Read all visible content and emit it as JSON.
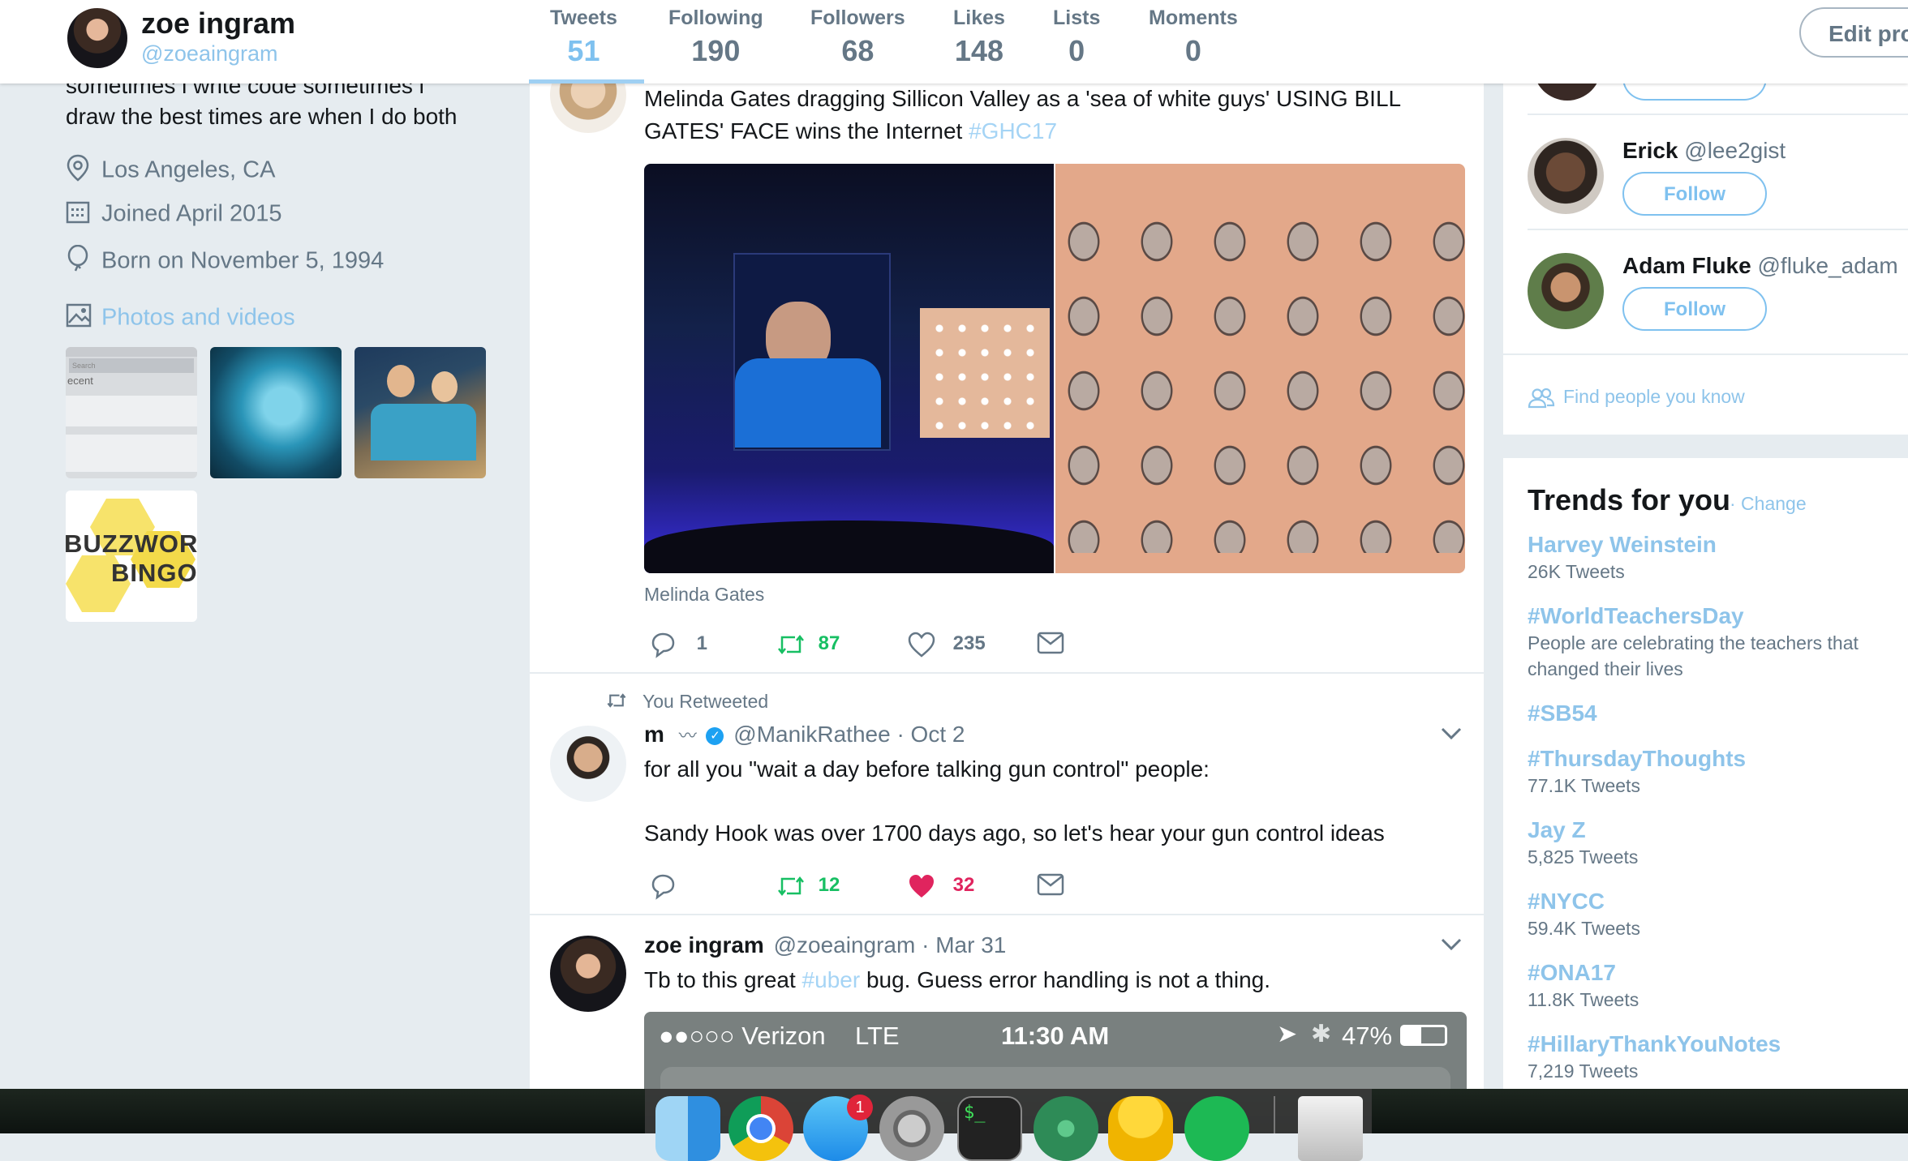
{
  "profile": {
    "name": "zoe ingram",
    "handle": "@zoeaingram",
    "bio_line1": "sometimes i write code sometimes i",
    "bio_line2": "draw the best times are when I do both",
    "location": "Los Angeles, CA",
    "joined": "Joined April 2015",
    "born": "Born on November 5, 1994",
    "photos_label": "Photos and videos",
    "edit_button": "Edit pro"
  },
  "stats": [
    {
      "label": "Tweets",
      "value": "51"
    },
    {
      "label": "Following",
      "value": "190"
    },
    {
      "label": "Followers",
      "value": "68"
    },
    {
      "label": "Likes",
      "value": "148"
    },
    {
      "label": "Lists",
      "value": "0"
    },
    {
      "label": "Moments",
      "value": "0"
    }
  ],
  "thumbs": {
    "t1_search": "Search",
    "t1_recent": "ecent",
    "t5_line1": "BUZZWORD",
    "t5_line2": "BINGO"
  },
  "tweet1": {
    "text_line1": "Melinda Gates dragging Sillicon Valley as a 'sea of white guys' USING BILL",
    "text_line2": "GATES' FACE wins the Internet ",
    "hashtag": "#GHC17",
    "caption": "Melinda Gates",
    "replies": "1",
    "retweets": "87",
    "likes": "235"
  },
  "tweet2": {
    "retweet_note": "You Retweeted",
    "author": "m",
    "author_deco": "〰",
    "handle": "@ManikRathee",
    "date": "· Oct 2",
    "line1": "for all you \"wait a day before talking gun control\" people:",
    "line2": "Sandy Hook was over 1700 days ago, so let's hear your gun control ideas",
    "retweets": "12",
    "likes": "32"
  },
  "tweet3": {
    "author": "zoe ingram",
    "handle": "@zoeaingram",
    "date": "· Mar 31",
    "text_before": "Tb to this great ",
    "hashtag": "#uber",
    "text_after": " bug. Guess error handling is not a thing.",
    "phone_carrier": "●●○○○ Verizon",
    "phone_network": "LTE",
    "phone_time": "11:30 AM",
    "phone_battery": "47%"
  },
  "who_to_follow": [
    {
      "name": "Erick",
      "handle": "@lee2gist",
      "button": "Follow"
    },
    {
      "name": "Adam Fluke",
      "handle": "@fluke_adam",
      "button": "Follow"
    }
  ],
  "find_people": "Find people you know",
  "trends": {
    "title": "Trends for you",
    "change": "· Change",
    "items": [
      {
        "name": "Harvey Weinstein",
        "count": "26K Tweets"
      },
      {
        "name": "#WorldTeachersDay",
        "count": "People are celebrating the teachers that",
        "count2": "changed their lives"
      },
      {
        "name": "#SB54",
        "count": ""
      },
      {
        "name": "#ThursdayThoughts",
        "count": "77.1K Tweets"
      },
      {
        "name": "Jay Z",
        "count": "5,825 Tweets"
      },
      {
        "name": "#NYCC",
        "count": "59.4K Tweets"
      },
      {
        "name": "#ONA17",
        "count": "11.8K Tweets"
      },
      {
        "name": "#HillaryThankYouNotes",
        "count": "7,219 Tweets"
      }
    ]
  },
  "dock": {
    "mail_badge": "1",
    "terminal_label": "$_"
  },
  "colors": {
    "accent": "#1da1f2",
    "retweet_green": "#17bf63",
    "like_red": "#e0245e"
  }
}
